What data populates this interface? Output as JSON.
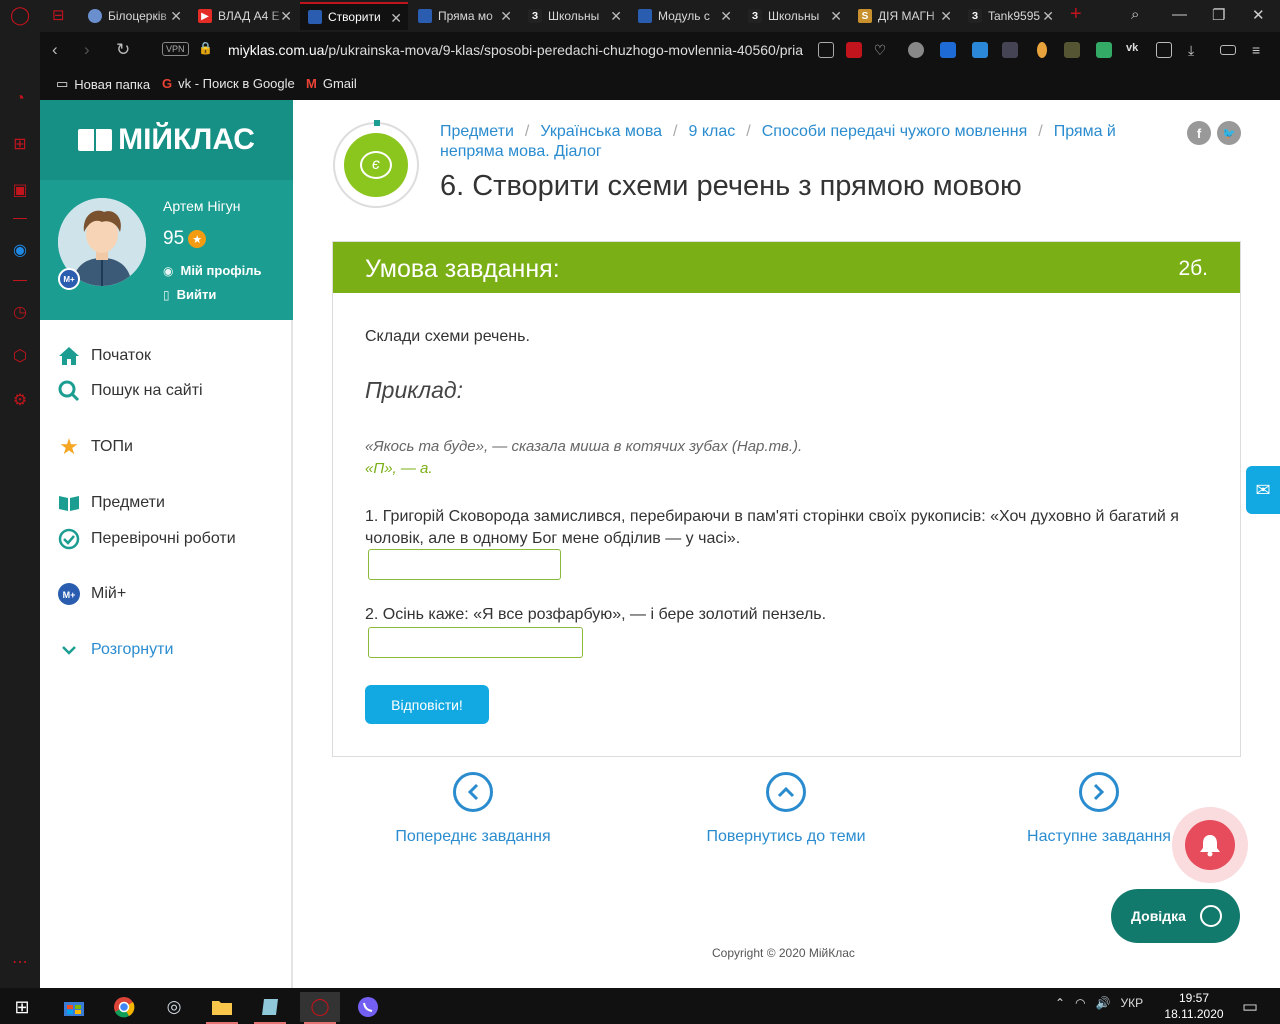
{
  "browser": {
    "tabs": [
      {
        "title": "Білоцерків",
        "favicon_color": "#6a8fcf",
        "active": false
      },
      {
        "title": "ВЛАД А4 E",
        "favicon_color": "#e52d27",
        "active": false
      },
      {
        "title": "Створити",
        "favicon_color": "#2a5db0",
        "active": true
      },
      {
        "title": "Пряма мо",
        "favicon_color": "#2a5db0",
        "active": false
      },
      {
        "title": "Школьны",
        "favicon_color": "#222222",
        "active": false
      },
      {
        "title": "Модуль с",
        "favicon_color": "#2a5db0",
        "active": false
      },
      {
        "title": "Школьны",
        "favicon_color": "#222222",
        "active": false
      },
      {
        "title": "ДІЯ МАГН",
        "favicon_color": "#c8912e",
        "active": false
      },
      {
        "title": "Tank9595",
        "favicon_color": "#222222",
        "active": false
      }
    ],
    "url_host": "miyklas.com.ua",
    "url_path": "/p/ukrainska-mova/9-klas/sposobi-peredachi-chuzhogo-movlennia-40560/pria",
    "vpn_label": "VPN",
    "bookmarks": [
      "Новая папка",
      "vk - Поиск в Google",
      "Gmail"
    ]
  },
  "site": {
    "logo": "МІЙКЛАС",
    "user": {
      "name": "Артем Нігун",
      "points": "95",
      "profile_link": "Мій профіль",
      "logout_link": "Вийти",
      "badge": "M+"
    },
    "menu": [
      {
        "label": "Початок",
        "icon": "home-icon"
      },
      {
        "label": "Пошук на сайті",
        "icon": "search-icon"
      },
      {
        "label": "ТОПи",
        "icon": "star-icon"
      },
      {
        "label": "Предмети",
        "icon": "book-icon"
      },
      {
        "label": "Перевірочні роботи",
        "icon": "check-circle-icon"
      },
      {
        "label": "Мій+",
        "icon": "myplus-icon"
      },
      {
        "label": "Розгорнути",
        "icon": "chevron-down-icon"
      }
    ]
  },
  "breadcrumb": [
    "Предмети",
    "Українська мова",
    "9 клас",
    "Способи передачі чужого мовлення",
    "Пряма й непряма мова. Діалог"
  ],
  "title": "6. Створити схеми речень з прямою мовою",
  "task": {
    "header": "Умова завдання:",
    "points": "2б.",
    "instruction": "Склади схеми речень.",
    "example_heading": "Приклад:",
    "example_sentence": "«Якось та буде», — сказала миша в котячих зубах (Нар.тв.).",
    "example_scheme": "«П», — а.",
    "questions": [
      {
        "text": "1.  Григорій Сковорода замислився, перебираючи в пам'яті сторінки своїх рукописів: «Хоч духовно й багатий я чоловік, але в одному Бог мене обділив — у часі».",
        "answer": ""
      },
      {
        "text": "2. Осінь каже: «Я все розфарбую», — і бере золотий пензель.",
        "answer": ""
      }
    ],
    "submit_label": "Відповісти!"
  },
  "nav": {
    "prev": "Попереднє завдання",
    "back": "Повернутись до теми",
    "next": "Наступне завдання"
  },
  "copyright": "Copyright © 2020 МійКлас",
  "help_label": "Довідка",
  "taskbar": {
    "language": "УКР",
    "time": "19:57",
    "date": "18.11.2020"
  },
  "colors": {
    "brand_teal": "#1b9e91",
    "task_green": "#7aaf15",
    "link_blue": "#2a8ccf",
    "button_blue": "#12a9e2",
    "opera_red": "#c1141c"
  }
}
